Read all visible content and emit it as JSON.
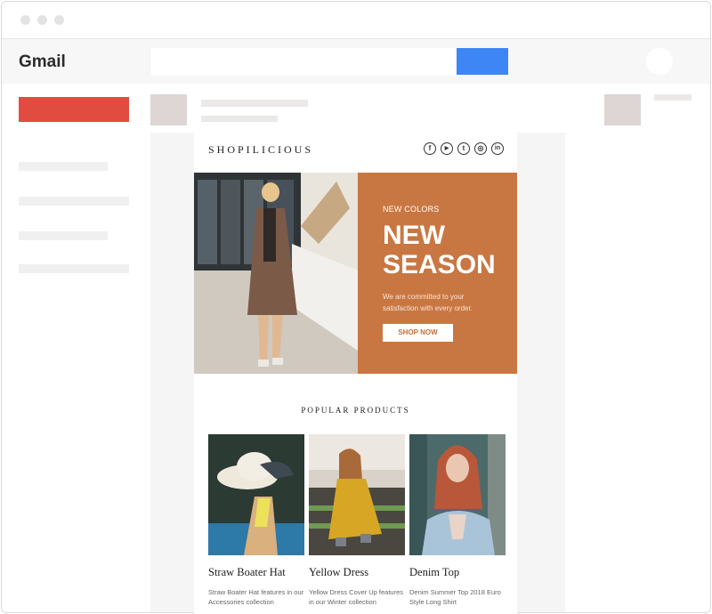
{
  "gmail": {
    "logo": "Gmail",
    "search_placeholder": ""
  },
  "email": {
    "brand": "SHOPILICIOUS",
    "social": [
      {
        "icon": "facebook-icon",
        "glyph": "f"
      },
      {
        "icon": "youtube-icon",
        "glyph": "▶"
      },
      {
        "icon": "twitter-icon",
        "glyph": "t"
      },
      {
        "icon": "instagram-icon",
        "glyph": "◎"
      },
      {
        "icon": "linkedin-icon",
        "glyph": "in"
      }
    ],
    "hero": {
      "eyebrow": "NEW COLORS",
      "headline_line1": "NEW",
      "headline_line2": "SEASON",
      "description": "We are committed to your satisfaction with every order.",
      "cta": "SHOP NOW"
    },
    "section_title": "POPULAR PRODUCTS",
    "products": [
      {
        "name": "Straw Boater Hat",
        "description": "Straw Boater Hat features in our Accessories collection"
      },
      {
        "name": "Yellow Dress",
        "description": "Yellow Dress Cover Up features in our Winter collection"
      },
      {
        "name": "Denim Top",
        "description": "Denim Summer Top 2018 Euro Style Long Shirt"
      }
    ]
  },
  "colors": {
    "compose": "#e24c40",
    "search_button": "#3e86f5",
    "hero_panel": "#c97742"
  }
}
